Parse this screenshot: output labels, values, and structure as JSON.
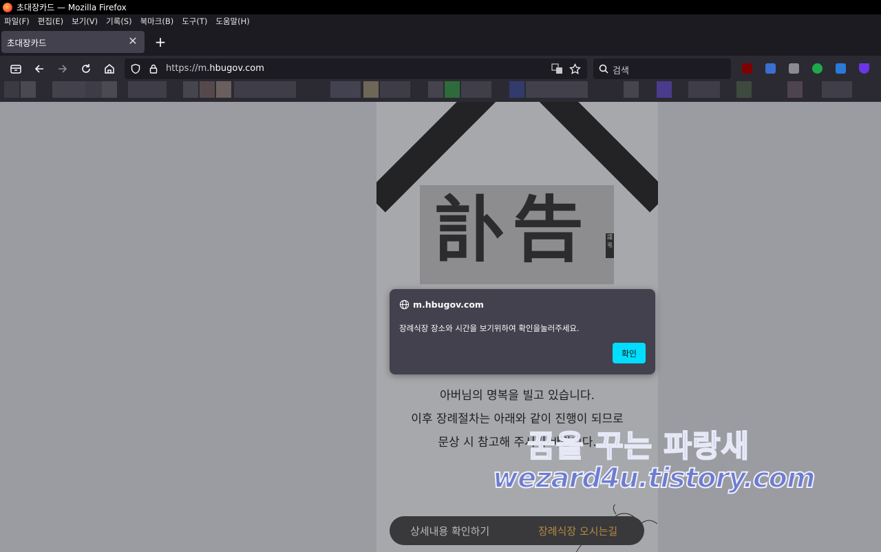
{
  "window": {
    "title": "초대장카드 — Mozilla Firefox"
  },
  "menu": {
    "items": [
      "파일(F)",
      "편집(E)",
      "보기(V)",
      "기록(S)",
      "북마크(B)",
      "도구(T)",
      "도움말(H)"
    ]
  },
  "tab": {
    "title": "초대장카드",
    "close": "✕",
    "new": "+"
  },
  "urlbar": {
    "scheme": "https://m.",
    "domain": "hbugov.com"
  },
  "search": {
    "placeholder": "검색"
  },
  "page": {
    "title_hanja": "訃告",
    "tag": "謹弔",
    "message_lines": [
      "아버님의 명복을 빌고 있습니다.",
      "이후 장례절차는 아래와 같이 진행이 되므로",
      "문상 시 참고해 주시기 바랍니다."
    ],
    "bottom_left": "상세내용 확인하기",
    "bottom_right": "장례식장 오시는길"
  },
  "watermark": {
    "line1": "꿈을 꾸는 파랑새",
    "line2": "wezard4u.tistory.com"
  },
  "dialog": {
    "host": "m.hbugov.com",
    "message": "장례식장 장소와 시간을 보기위하여 확인을눌러주세요.",
    "ok_label": "확인"
  },
  "colors": {
    "accent": "#00ddff",
    "chrome": "#2b2a33",
    "dialog": "#42414d"
  },
  "icons": [
    "firefox-logo-icon",
    "collections-icon",
    "back-icon",
    "forward-icon",
    "reload-icon",
    "home-icon",
    "shield-icon",
    "lock-icon",
    "translate-icon",
    "star-icon",
    "search-icon",
    "globe-icon"
  ]
}
